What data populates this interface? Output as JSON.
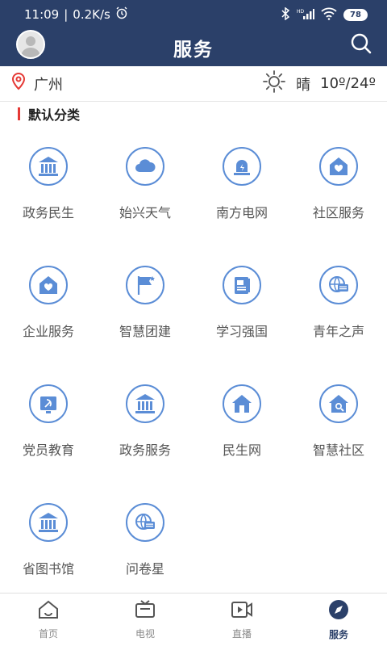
{
  "status_bar": {
    "time": "11:09",
    "speed": "0.2K/s",
    "network": "HD",
    "battery": "78"
  },
  "header": {
    "title": "服务"
  },
  "location": {
    "city": "广州",
    "weather_text": "晴",
    "temperature": "10º/24º"
  },
  "section": {
    "title": "默认分类"
  },
  "services": [
    {
      "label": "政务民生",
      "icon": "government-building-icon"
    },
    {
      "label": "始兴天气",
      "icon": "cloud-icon"
    },
    {
      "label": "南方电网",
      "icon": "alarm-light-icon"
    },
    {
      "label": "社区服务",
      "icon": "community-home-icon"
    },
    {
      "label": "企业服务",
      "icon": "enterprise-home-icon"
    },
    {
      "label": "智慧团建",
      "icon": "flag-icon"
    },
    {
      "label": "学习强国",
      "icon": "book-icon"
    },
    {
      "label": "青年之声",
      "icon": "globe-chat-icon"
    },
    {
      "label": "党员教育",
      "icon": "party-emblem-icon"
    },
    {
      "label": "政务服务",
      "icon": "government-building-icon"
    },
    {
      "label": "民生网",
      "icon": "house-icon"
    },
    {
      "label": "智慧社区",
      "icon": "house-search-icon"
    },
    {
      "label": "省图书馆",
      "icon": "library-building-icon"
    },
    {
      "label": "问卷星",
      "icon": "globe-chat-icon"
    }
  ],
  "tabs": [
    {
      "label": "首页",
      "icon": "home-icon",
      "active": false
    },
    {
      "label": "电视",
      "icon": "tv-icon",
      "active": false
    },
    {
      "label": "直播",
      "icon": "live-video-icon",
      "active": false
    },
    {
      "label": "服务",
      "icon": "compass-icon",
      "active": true
    }
  ],
  "colors": {
    "header_bg": "#2b4069",
    "icon_accent": "#5b8dd6",
    "section_mark": "#e53935"
  }
}
